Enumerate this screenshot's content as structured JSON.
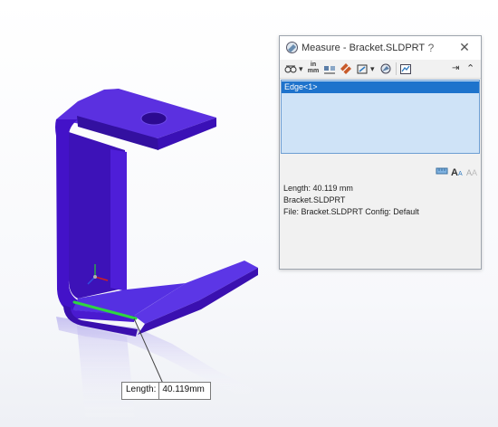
{
  "window": {
    "title": "Measure - Bracket.SLDPRT",
    "help": "?",
    "close": "✕"
  },
  "toolbar": {
    "units_label": "in\nmm",
    "units_top": "in",
    "units_bottom": "mm",
    "collapse": "⌃"
  },
  "selection": {
    "items": [
      "Edge<1>"
    ]
  },
  "results": {
    "length": "Length: 40.119 mm",
    "part": "Bracket.SLDPRT",
    "file": "File: Bracket.SLDPRT Config: Default"
  },
  "callout": {
    "label": "Length:",
    "value": "40.119mm"
  },
  "colors": {
    "part": "#4a16d8",
    "highlight": "#2fd640",
    "selection": "#1e73cc",
    "list_bg": "#cfe3f7"
  }
}
